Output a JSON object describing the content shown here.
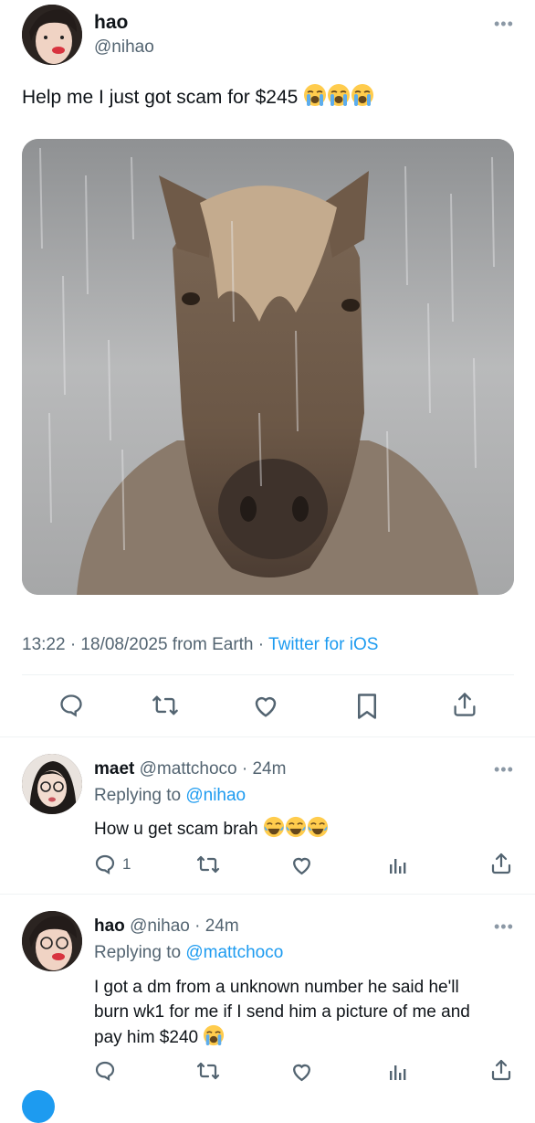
{
  "main_tweet": {
    "author_name": "hao",
    "author_handle": "@nihao",
    "text": "Help me I just got scam for $245",
    "emoji": [
      "loudly-crying-face",
      "loudly-crying-face",
      "loudly-crying-face"
    ],
    "meta_time": "13:22 · 18/08/2025 from Earth · ",
    "meta_client": "Twitter for iOS",
    "actions": [
      "reply-icon",
      "retweet-icon",
      "like-icon",
      "bookmark-icon",
      "share-icon"
    ]
  },
  "replies": [
    {
      "author_name": "maet",
      "author_handle": "@mattchoco",
      "time": " · 24m",
      "replying_label": "Replying to ",
      "replying_to": "@nihao",
      "text": "How u get scam brah",
      "emoji": [
        "face-with-tears-of-joy",
        "face-with-tears-of-joy",
        "face-with-tears-of-joy"
      ],
      "reply_count": "1"
    },
    {
      "author_name": "hao",
      "author_handle": "@nihao",
      "time": " · 24m",
      "replying_label": "Replying to ",
      "replying_to": "@mattchoco",
      "text_lines": [
        "I got a dm from a unknown number he said he'll",
        "burn wk1 for me if I send him a picture of me and",
        "pay him $240"
      ],
      "emoji": [
        "loudly-crying-face"
      ]
    }
  ],
  "colors": {
    "link": "#1d9bf0",
    "muted": "#536471",
    "divider": "#eff3f4"
  }
}
